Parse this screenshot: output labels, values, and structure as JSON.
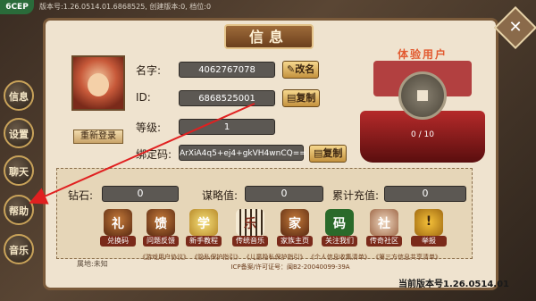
{
  "status_bar": {
    "badge": "6CEP",
    "version_info": "版本号:1.26.0514.01.6868525, 创建版本:0, 档位:0"
  },
  "side_nav": [
    {
      "label": "信息",
      "icon": "info-icon"
    },
    {
      "label": "设置",
      "icon": "settings-icon"
    },
    {
      "label": "聊天",
      "icon": "chat-icon"
    },
    {
      "label": "帮助",
      "icon": "help-icon"
    },
    {
      "label": "音乐",
      "icon": "music-icon"
    }
  ],
  "panel": {
    "title": "信息",
    "close_icon": "close-icon"
  },
  "profile": {
    "name_label": "名字:",
    "name_value": "4062767078",
    "rename_button": "改名",
    "id_label": "ID:",
    "id_value": "6868525001",
    "copy_button": "复制",
    "level_label": "等级:",
    "level_value": "1",
    "bind_label": "绑定码:",
    "bind_value": "ArXiA4q5+ej4+gkVH4wnCQ==",
    "bind_copy_button": "复制",
    "relogin_button": "重新登录"
  },
  "trial_user": {
    "title": "体验用户",
    "progress_text": "0 / 10",
    "progress_current": 0,
    "progress_max": 10
  },
  "stats": {
    "diamond_label": "钻石:",
    "diamond_value": "0",
    "strategy_label": "谋略值:",
    "strategy_value": "0",
    "recharge_label": "累计充值:",
    "recharge_value": "0"
  },
  "features": [
    {
      "label": "兑换码",
      "icon": "gift-icon",
      "glyph": "礼"
    },
    {
      "label": "问题反馈",
      "icon": "feedback-icon",
      "glyph": "馈"
    },
    {
      "label": "新手教程",
      "icon": "tutorial-icon",
      "glyph": "学"
    },
    {
      "label": "传统音乐",
      "icon": "music-keys-icon",
      "glyph": "乐"
    },
    {
      "label": "家族主页",
      "icon": "house-icon",
      "glyph": "家"
    },
    {
      "label": "关注我们",
      "icon": "qrcode-icon",
      "glyph": "码"
    },
    {
      "label": "传奇社区",
      "icon": "community-icon",
      "glyph": "社"
    },
    {
      "label": "举报",
      "icon": "warning-icon",
      "glyph": "!"
    }
  ],
  "footer": {
    "location": "属地:未知",
    "links": "《游戏用户协议》 《隐私保护指引》 《儿童隐私保护指引》 《个人信息收集清单》 《第三方信息共享清单》",
    "icp": "ICP备案/许可证号：闽B2-20040099-39A",
    "version": "当前版本号1.26.0514.01"
  }
}
